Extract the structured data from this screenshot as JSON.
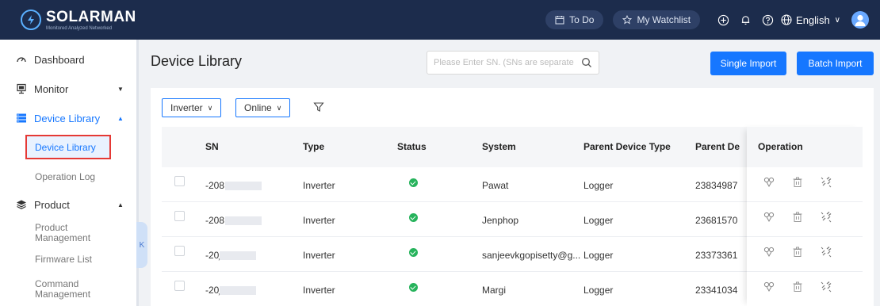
{
  "brand": {
    "name": "SOLARMAN",
    "tagline": "Monitored Analyzed Networked"
  },
  "topbar": {
    "todo_label": "To Do",
    "watchlist_label": "My Watchlist",
    "language_label": "English"
  },
  "sidebar": {
    "dashboard": "Dashboard",
    "monitor": "Monitor",
    "device_library": "Device Library",
    "device_library_sub": "Device Library",
    "operation_log": "Operation Log",
    "product": "Product",
    "product_management": "Product Management",
    "firmware_list": "Firmware List",
    "command_management": "Command Management"
  },
  "main": {
    "title": "Device Library",
    "search_placeholder": "Please Enter SN. (SNs are separate",
    "single_import": "Single Import",
    "batch_import": "Batch Import",
    "filter_type": "Inverter",
    "filter_status": "Online"
  },
  "table": {
    "headers": {
      "sn": "SN",
      "type": "Type",
      "status": "Status",
      "system": "System",
      "parent_type": "Parent Device Type",
      "parent_sn": "Parent De",
      "operation": "Operation"
    },
    "rows": [
      {
        "sn": "-208",
        "type": "Inverter",
        "status": "online",
        "system": "Pawat",
        "parent_type": "Logger",
        "parent_sn": "23834987"
      },
      {
        "sn": "-208",
        "type": "Inverter",
        "status": "online",
        "system": "Jenphop",
        "parent_type": "Logger",
        "parent_sn": "23681570"
      },
      {
        "sn": "-20̹",
        "type": "Inverter",
        "status": "online",
        "system": "sanjeevkgopisetty@g...",
        "parent_type": "Logger",
        "parent_sn": "23373361"
      },
      {
        "sn": "-20̹",
        "type": "Inverter",
        "status": "online",
        "system": "Margi",
        "parent_type": "Logger",
        "parent_sn": "23341034"
      }
    ]
  },
  "colors": {
    "topbar": "#1c2c4c",
    "accent": "#1677ff",
    "status_ok": "#27b35c",
    "highlight_box": "#e53935"
  }
}
